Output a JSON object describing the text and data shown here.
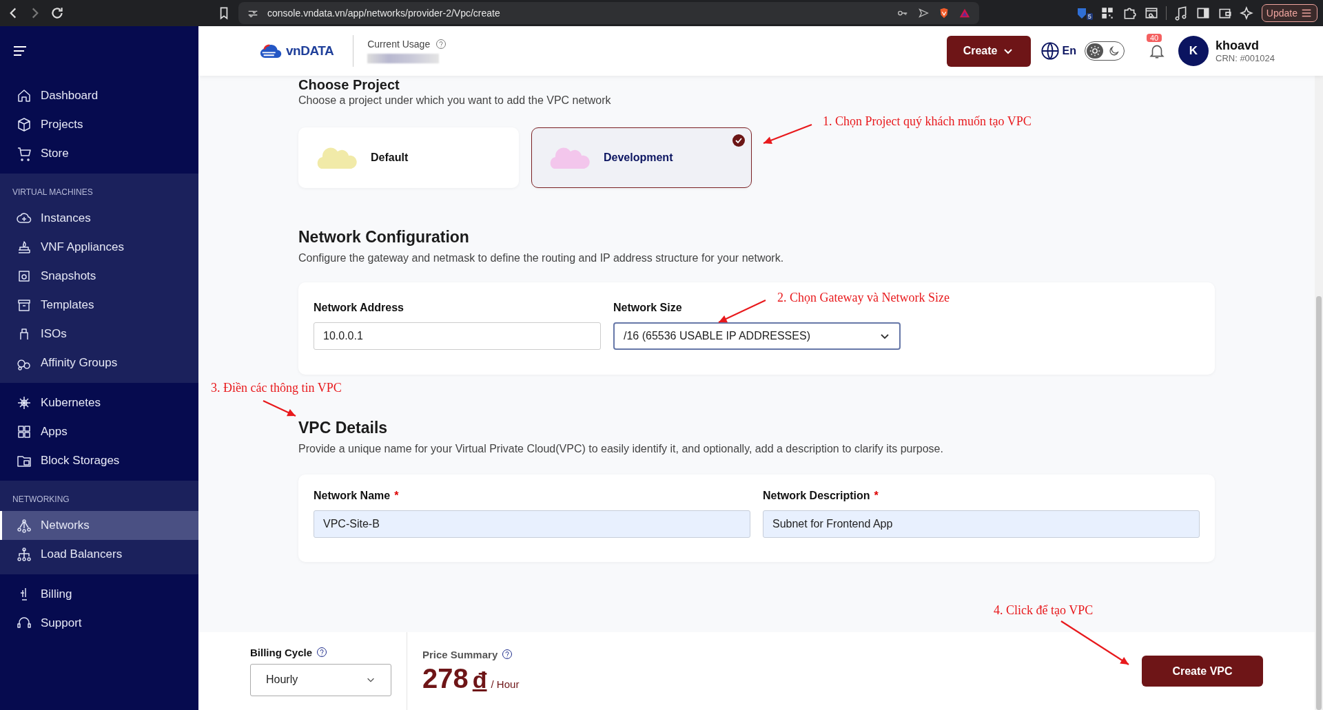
{
  "browser": {
    "url": "console.vndata.vn/app/networks/provider-2/Vpc/create",
    "update_button": "Update",
    "extension_badge": "5"
  },
  "header": {
    "logo": "vnDATA",
    "usage_label": "Current Usage",
    "create_button": "Create",
    "language": "En",
    "dark_mode": false,
    "notification_count": "40",
    "user": {
      "initial": "K",
      "name": "khoavd",
      "crn": "CRN: #001024"
    }
  },
  "sidebar": {
    "sections": [
      {
        "kind": "plain",
        "items": [
          {
            "label": "Dashboard",
            "selected": false
          },
          {
            "label": "Projects",
            "selected": false
          },
          {
            "label": "Store",
            "selected": false
          }
        ]
      },
      {
        "kind": "group",
        "label": "VIRTUAL MACHINES",
        "items": [
          {
            "label": "Instances",
            "selected": false
          },
          {
            "label": "VNF Appliances",
            "selected": false
          },
          {
            "label": "Snapshots",
            "selected": false
          },
          {
            "label": "Templates",
            "selected": false
          },
          {
            "label": "ISOs",
            "selected": false
          },
          {
            "label": "Affinity Groups",
            "selected": false
          }
        ]
      },
      {
        "kind": "plain",
        "items": [
          {
            "label": "Kubernetes",
            "selected": false
          },
          {
            "label": "Apps",
            "selected": false
          },
          {
            "label": "Block Storages",
            "selected": false
          }
        ]
      },
      {
        "kind": "group",
        "label": "NETWORKING",
        "items": [
          {
            "label": "Networks",
            "selected": true
          },
          {
            "label": "Load Balancers",
            "selected": false
          }
        ]
      },
      {
        "kind": "plain",
        "items": [
          {
            "label": "Billing",
            "selected": false
          },
          {
            "label": "Support",
            "selected": false
          }
        ]
      }
    ]
  },
  "project_section": {
    "title": "Choose Project",
    "description": "Choose a project under which you want to add the VPC network",
    "projects": [
      {
        "name": "Default",
        "color": "#f1eaa8",
        "selected": false
      },
      {
        "name": "Development",
        "color": "#f3c6ec",
        "selected": true
      }
    ]
  },
  "network_config": {
    "title": "Network Configuration",
    "description": "Configure the gateway and netmask to define the routing and IP address structure for your network.",
    "fields": [
      {
        "kind": "text",
        "label": "Network Address",
        "value": "10.0.0.1"
      },
      {
        "kind": "select",
        "label": "Network Size",
        "value": "/16 (65536 USABLE IP ADDRESSES)"
      }
    ]
  },
  "vpc_details": {
    "title": "VPC Details",
    "description": "Provide a unique name for your Virtual Private Cloud(VPC) to easily identify it, and optionally, add a description to clarify its purpose.",
    "fields": [
      {
        "label": "Network Name",
        "required_mark": "*",
        "value": "VPC-Site-B"
      },
      {
        "label": "Network Description",
        "required_mark": "*",
        "value": "Subnet for Frontend App"
      }
    ]
  },
  "footer": {
    "billing_label": "Billing Cycle",
    "billing_value": "Hourly",
    "price_label": "Price Summary",
    "price": "278",
    "currency": "đ",
    "unit": "/ Hour",
    "create_button": "Create VPC"
  },
  "annotations": [
    {
      "text": "1. Chọn Project quý khách muốn tạo VPC"
    },
    {
      "text": "2. Chọn Gateway và Network Size"
    },
    {
      "text": "3. Điền các thông tin VPC"
    },
    {
      "text": "4. Click để tạo VPC"
    }
  ]
}
